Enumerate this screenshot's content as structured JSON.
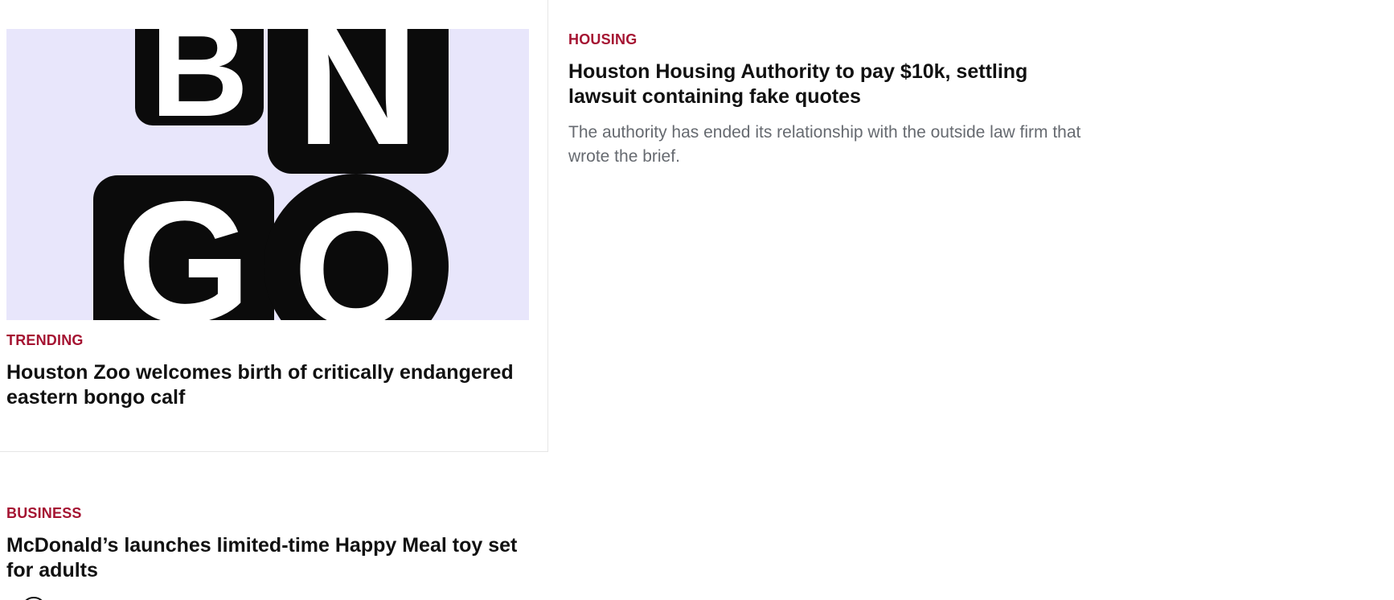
{
  "stories": {
    "trending": {
      "kicker": "TRENDING",
      "headline": "Houston Zoo welcomes birth of critically endangered eastern bongo calf",
      "thumbnail": {
        "letters": [
          "B",
          "N",
          "G",
          "O"
        ],
        "background": "#e8e6fb",
        "tile_color": "#0b0b0b"
      }
    },
    "housing": {
      "kicker": "HOUSING",
      "headline": "Houston Housing Authority to pay $10k, settling lawsuit containing fake quotes",
      "dek": "The authority has ended its relationship with the outside law firm that wrote the brief."
    },
    "business": {
      "kicker": "BUSINESS",
      "headline": "McDonald’s launches limited-time Happy Meal toy set for adults"
    }
  },
  "colors": {
    "kicker": "#a51432",
    "headline": "#111111",
    "dek": "#666a70",
    "divider": "#e6e6e6"
  }
}
